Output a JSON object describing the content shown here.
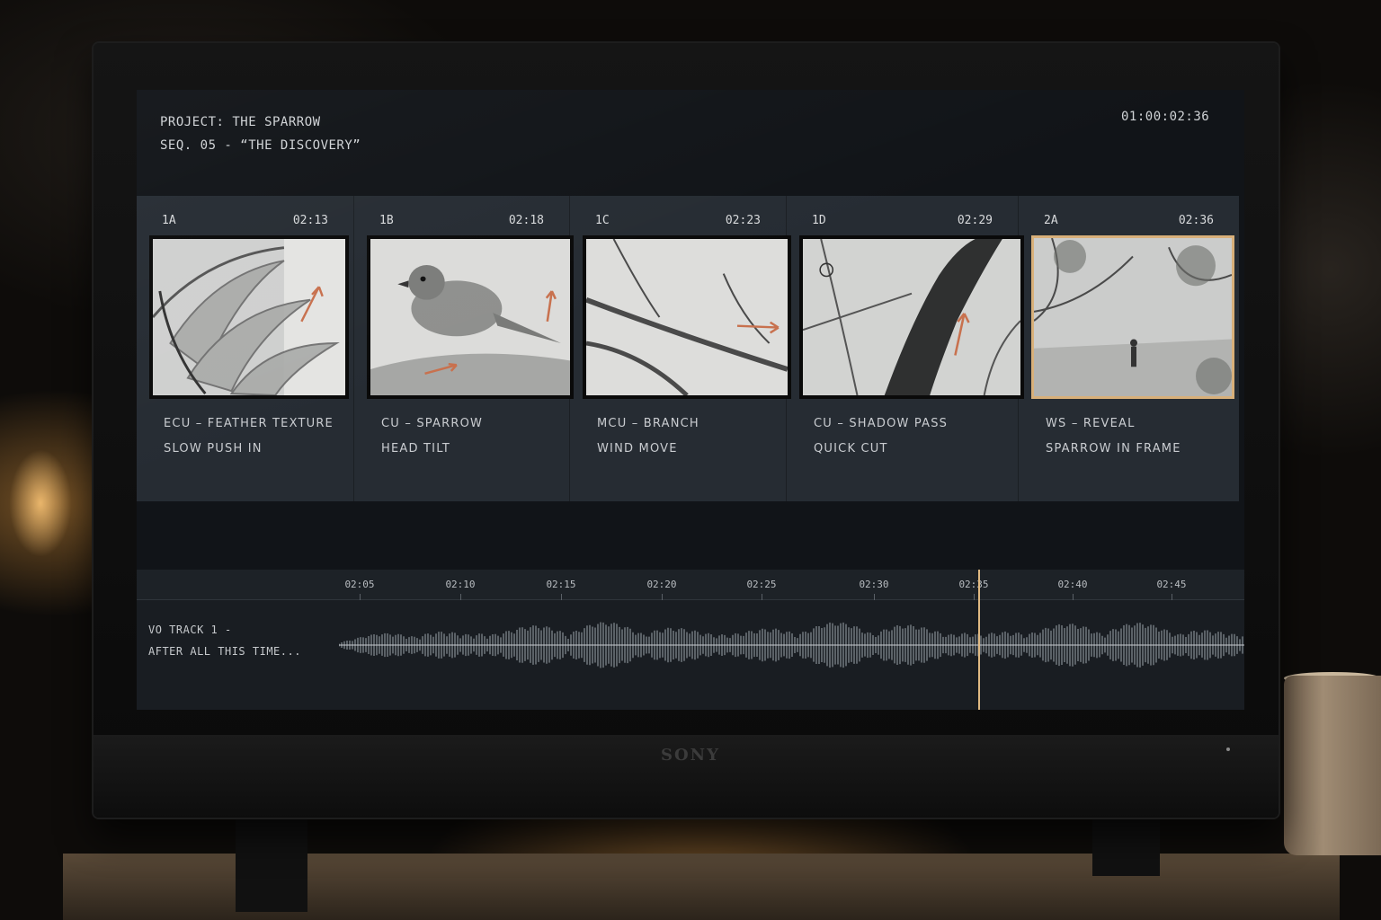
{
  "header": {
    "project": "PROJECT: THE SPARROW",
    "sequence": "SEQ. 05 - “THE DISCOVERY”",
    "timecode": "01:00:02:36"
  },
  "monitor": {
    "brand": "SONY"
  },
  "panels": [
    {
      "id": "1A",
      "time": "02:13",
      "line1": "ECU – FEATHER TEXTURE",
      "line2": "SLOW PUSH IN",
      "sketch": "feather",
      "selected": false
    },
    {
      "id": "1B",
      "time": "02:18",
      "line1": "CU – SPARROW",
      "line2": "HEAD TILT",
      "sketch": "sparrow",
      "selected": false
    },
    {
      "id": "1C",
      "time": "02:23",
      "line1": "MCU – BRANCH",
      "line2": "WIND MOVE",
      "sketch": "branch",
      "selected": false
    },
    {
      "id": "1D",
      "time": "02:29",
      "line1": "CU – SHADOW PASS",
      "line2": "QUICK CUT",
      "sketch": "shadow",
      "selected": false
    },
    {
      "id": "2A",
      "time": "02:36",
      "line1": "WS – REVEAL",
      "line2": "SPARROW IN FRAME",
      "sketch": "reveal",
      "selected": true
    }
  ],
  "timeline": {
    "ticks": [
      "02:05",
      "02:10",
      "02:15",
      "02:20",
      "02:25",
      "02:30",
      "02:35",
      "02:40",
      "02:45"
    ],
    "track_name": "VO TRACK 1 -",
    "track_text": "AFTER ALL THIS TIME..."
  },
  "colors": {
    "accent_arrow": "#c8714e",
    "playhead": "#e0b982",
    "selected_frame": "#d8b07a"
  }
}
